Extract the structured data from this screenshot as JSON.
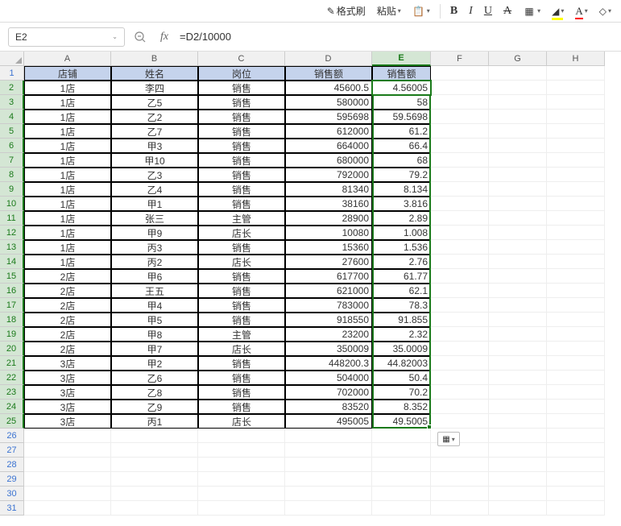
{
  "toolbar": {
    "format_brush": "格式刷",
    "paste": "粘贴"
  },
  "namebox": "E2",
  "formula": "=D2/10000",
  "columns": [
    "A",
    "B",
    "C",
    "D",
    "E",
    "F",
    "G",
    "H"
  ],
  "rowcount": 31,
  "headers": {
    "a": "店铺",
    "b": "姓名",
    "c": "岗位",
    "d": "销售额",
    "e": "销售额"
  },
  "rows": [
    {
      "a": "1店",
      "b": "李四",
      "c": "销售",
      "d": "45600.5",
      "e": "4.56005"
    },
    {
      "a": "1店",
      "b": "乙5",
      "c": "销售",
      "d": "580000",
      "e": "58"
    },
    {
      "a": "1店",
      "b": "乙2",
      "c": "销售",
      "d": "595698",
      "e": "59.5698"
    },
    {
      "a": "1店",
      "b": "乙7",
      "c": "销售",
      "d": "612000",
      "e": "61.2"
    },
    {
      "a": "1店",
      "b": "甲3",
      "c": "销售",
      "d": "664000",
      "e": "66.4"
    },
    {
      "a": "1店",
      "b": "甲10",
      "c": "销售",
      "d": "680000",
      "e": "68"
    },
    {
      "a": "1店",
      "b": "乙3",
      "c": "销售",
      "d": "792000",
      "e": "79.2"
    },
    {
      "a": "1店",
      "b": "乙4",
      "c": "销售",
      "d": "81340",
      "e": "8.134"
    },
    {
      "a": "1店",
      "b": "甲1",
      "c": "销售",
      "d": "38160",
      "e": "3.816"
    },
    {
      "a": "1店",
      "b": "张三",
      "c": "主管",
      "d": "28900",
      "e": "2.89"
    },
    {
      "a": "1店",
      "b": "甲9",
      "c": "店长",
      "d": "10080",
      "e": "1.008"
    },
    {
      "a": "1店",
      "b": "丙3",
      "c": "销售",
      "d": "15360",
      "e": "1.536"
    },
    {
      "a": "1店",
      "b": "丙2",
      "c": "店长",
      "d": "27600",
      "e": "2.76"
    },
    {
      "a": "2店",
      "b": "甲6",
      "c": "销售",
      "d": "617700",
      "e": "61.77"
    },
    {
      "a": "2店",
      "b": "王五",
      "c": "销售",
      "d": "621000",
      "e": "62.1"
    },
    {
      "a": "2店",
      "b": "甲4",
      "c": "销售",
      "d": "783000",
      "e": "78.3"
    },
    {
      "a": "2店",
      "b": "甲5",
      "c": "销售",
      "d": "918550",
      "e": "91.855"
    },
    {
      "a": "2店",
      "b": "甲8",
      "c": "主管",
      "d": "23200",
      "e": "2.32"
    },
    {
      "a": "2店",
      "b": "甲7",
      "c": "店长",
      "d": "350009",
      "e": "35.0009"
    },
    {
      "a": "3店",
      "b": "甲2",
      "c": "销售",
      "d": "448200.3",
      "e": "44.82003"
    },
    {
      "a": "3店",
      "b": "乙6",
      "c": "销售",
      "d": "504000",
      "e": "50.4"
    },
    {
      "a": "3店",
      "b": "乙8",
      "c": "销售",
      "d": "702000",
      "e": "70.2"
    },
    {
      "a": "3店",
      "b": "乙9",
      "c": "销售",
      "d": "83520",
      "e": "8.352"
    },
    {
      "a": "3店",
      "b": "丙1",
      "c": "店长",
      "d": "495005",
      "e": "49.5005"
    }
  ]
}
